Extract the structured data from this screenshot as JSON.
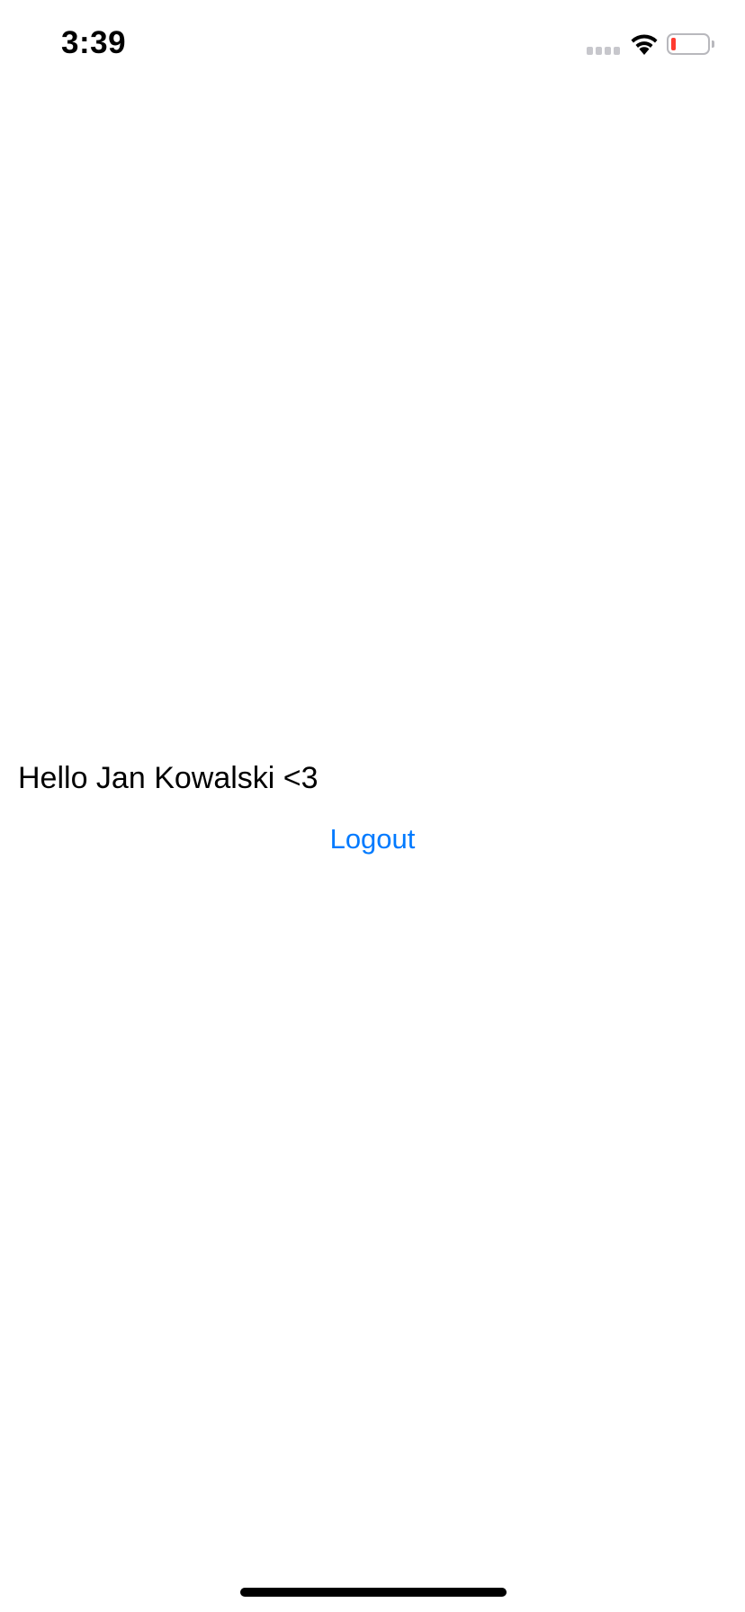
{
  "status_bar": {
    "time": "3:39",
    "signal_icon": "cellular-signal-icon",
    "wifi_icon": "wifi-icon",
    "battery_icon": "battery-icon",
    "battery_level_fraction": 0.1,
    "battery_fill_color": "#ff3b30"
  },
  "main": {
    "greeting": "Hello Jan Kowalski <3",
    "logout_label": "Logout"
  },
  "colors": {
    "accent": "#007aff",
    "text": "#000000",
    "background": "#ffffff"
  }
}
